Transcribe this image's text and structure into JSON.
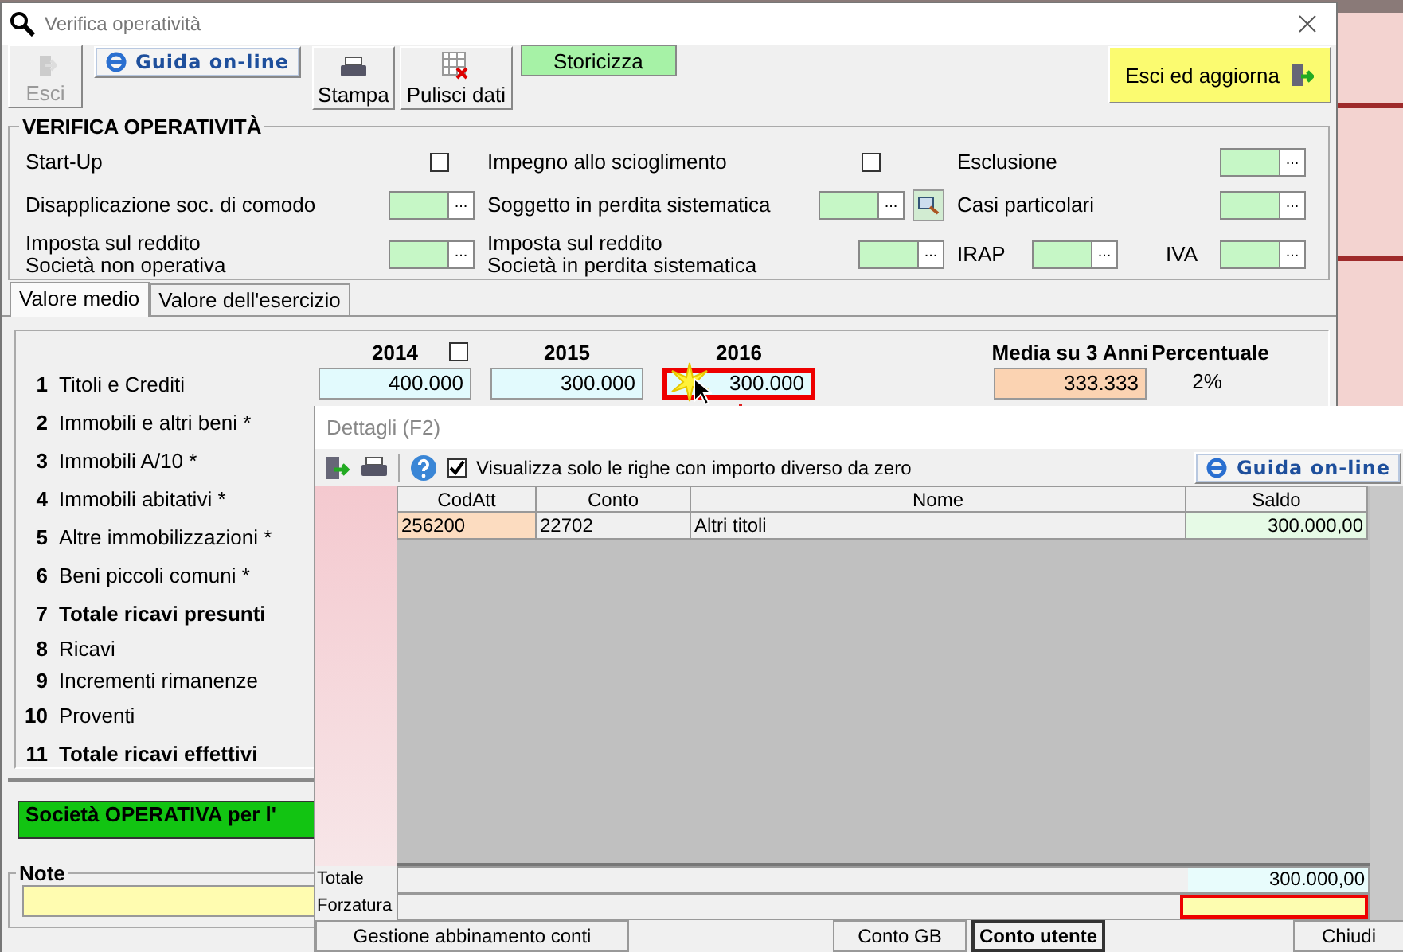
{
  "window": {
    "title": "Verifica operatività"
  },
  "toolbar": [
    {
      "kind": "exit",
      "label": "Esci",
      "disabled": true
    },
    {
      "kind": "help",
      "label": "Guida on-line"
    },
    {
      "kind": "print",
      "label": "Stampa"
    },
    {
      "kind": "clear",
      "label": "Pulisci dati"
    },
    {
      "kind": "history",
      "label": "Storicizza"
    },
    {
      "kind": "update",
      "label": "Esci ed aggiorna"
    }
  ],
  "section": {
    "title": "VERIFICA OPERATIVITÀ",
    "cells": [
      {
        "items": [
          {
            "label": "Start-Up",
            "kind": "checkbox",
            "checked": false
          }
        ]
      },
      {
        "items": [
          {
            "label": "Impegno allo scioglimento",
            "kind": "checkbox",
            "checked": false
          }
        ]
      },
      {
        "items": [
          {
            "label": "Esclusione",
            "kind": "picker",
            "button": "..."
          }
        ]
      },
      {
        "items": [
          {
            "label": "Disapplicazione soc. di comodo",
            "kind": "picker",
            "button": "..."
          }
        ]
      },
      {
        "items": [
          {
            "label": "Soggetto in perdita sistematica",
            "kind": "picker_search",
            "button": "..."
          }
        ]
      },
      {
        "items": [
          {
            "label": "Casi particolari",
            "kind": "picker",
            "button": "..."
          }
        ]
      },
      {
        "items": [
          {
            "label": "Imposta sul reddito\nSocietà non operativa",
            "kind": "picker",
            "button": "..."
          }
        ]
      },
      {
        "items": [
          {
            "label": "Imposta sul reddito\nSocietà in perdita sistematica",
            "kind": "picker",
            "button": "..."
          }
        ]
      },
      {
        "items": [
          {
            "label": "IRAP",
            "kind": "picker",
            "button": "..."
          },
          {
            "label": "IVA",
            "kind": "picker",
            "button": "..."
          }
        ]
      }
    ]
  },
  "tabs": [
    {
      "label": "Valore medio",
      "selected": true
    },
    {
      "label": "Valore dell'esercizio",
      "selected": false
    }
  ],
  "grid": {
    "columns": [
      {
        "label": "2014",
        "checked": false
      },
      {
        "label": "2015"
      },
      {
        "label": "2016"
      },
      {
        "label": "Media su 3 Anni"
      },
      {
        "label": "Percentuale"
      }
    ],
    "rows": [
      {
        "number": "1",
        "label": "Titoli e Crediti",
        "bold": false,
        "values": [
          {
            "text": "400.000",
            "kind": "input",
            "highlighted": false
          },
          {
            "text": "300.000",
            "kind": "input",
            "highlighted": false
          },
          {
            "text": "300.000",
            "kind": "input",
            "highlighted": true
          },
          {
            "text": "333.333",
            "kind": "average",
            "highlighted": false
          },
          {
            "text": "2%",
            "kind": "plain",
            "highlighted": false
          }
        ]
      },
      {
        "number": "2",
        "label": "Immobili e altri beni  *",
        "bold": false,
        "values": []
      },
      {
        "number": "3",
        "label": "Immobili A/10 *",
        "bold": false,
        "values": []
      },
      {
        "number": "4",
        "label": "Immobili abitativi *",
        "bold": false,
        "values": []
      },
      {
        "number": "5",
        "label": "Altre immobilizzazioni *",
        "bold": false,
        "values": []
      },
      {
        "number": "6",
        "label": "Beni piccoli comuni  *",
        "bold": false,
        "values": []
      },
      {
        "number": "7",
        "label": "Totale ricavi presunti",
        "bold": true,
        "values": []
      },
      {
        "number": "8",
        "label": "Ricavi",
        "bold": false,
        "values": []
      },
      {
        "number": "9",
        "label": "Incrementi rimanenze",
        "bold": false,
        "values": []
      },
      {
        "number": "10",
        "label": "Proventi",
        "bold": false,
        "values": []
      },
      {
        "number": "11",
        "label": "Totale ricavi effettivi",
        "bold": true,
        "values": []
      }
    ]
  },
  "status": {
    "text": "Società OPERATIVA per l'"
  },
  "note": {
    "title": "Note"
  },
  "dialog": {
    "title": "Dettagli (F2)",
    "filter": {
      "label": "Visualizza solo le righe con importo diverso da zero",
      "checked": true
    },
    "help": "Guida on-line",
    "columns": [
      "CodAtt",
      "Conto",
      "Nome",
      "Saldo"
    ],
    "rows": [
      {
        "cells": [
          "256200",
          "22702",
          "Altri titoli",
          "300.000,00"
        ]
      }
    ],
    "total_label": "Totale",
    "total": "300.000,00",
    "override_label": "Forzatura",
    "buttons": [
      {
        "label": "Gestione abbinamento conti",
        "selected": false
      },
      {
        "label": "Conto GB",
        "selected": false
      },
      {
        "label": "Conto utente",
        "selected": true
      },
      {
        "label": "Chiudi",
        "selected": false
      }
    ]
  }
}
